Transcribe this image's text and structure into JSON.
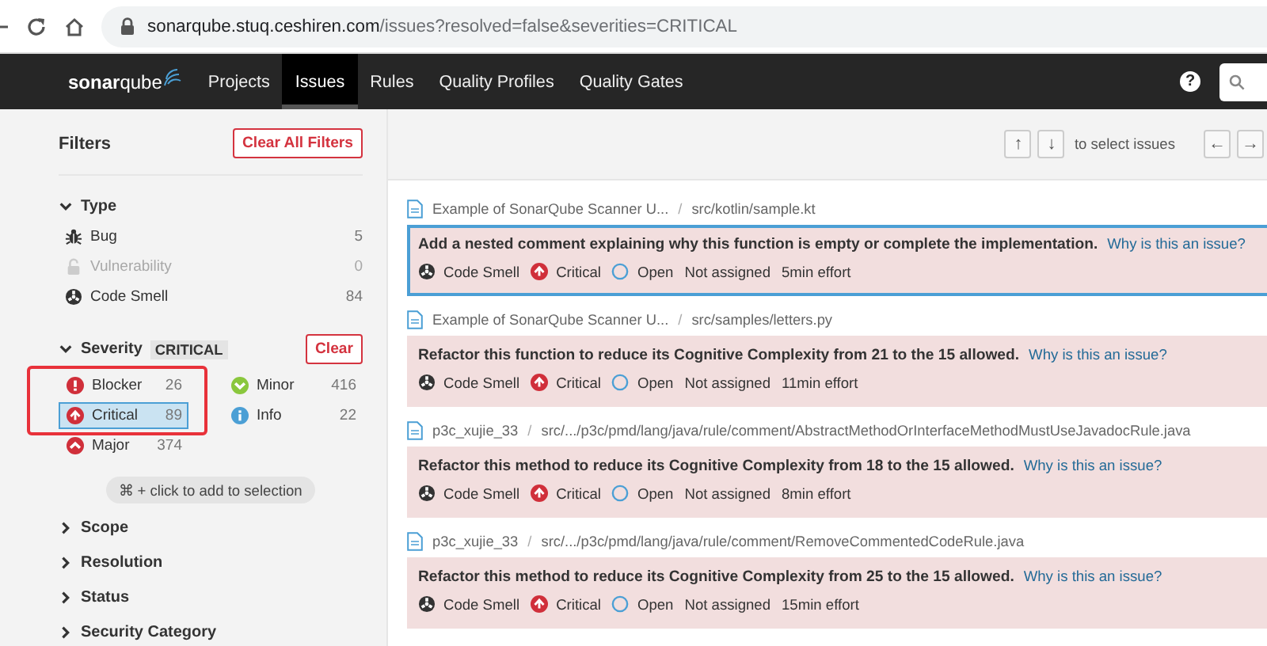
{
  "browser": {
    "url_host": "sonarqube.stuq.ceshiren.com",
    "url_path": "/issues?resolved=false&severities=CRITICAL"
  },
  "nav": {
    "logo": "**sonar**qube",
    "items": [
      {
        "label": "Projects",
        "selected": false
      },
      {
        "label": "Issues",
        "selected": true
      },
      {
        "label": "Rules",
        "selected": false
      },
      {
        "label": "Quality Profiles",
        "selected": false
      },
      {
        "label": "Quality Gates",
        "selected": false
      }
    ],
    "help": "?"
  },
  "sidebar": {
    "title": "Filters",
    "clear_all": "Clear All Filters",
    "type_facet": {
      "title": "Type",
      "expanded": true,
      "items": [
        {
          "kind": "bug",
          "label": "Bug",
          "count": "5",
          "disabled": false
        },
        {
          "kind": "vulnerability",
          "label": "Vulnerability",
          "count": "0",
          "disabled": true
        },
        {
          "kind": "code_smell",
          "label": "Code Smell",
          "count": "84",
          "disabled": false
        }
      ]
    },
    "severity_facet": {
      "title": "Severity",
      "expanded": true,
      "value": "CRITICAL",
      "clear": "Clear",
      "items": [
        {
          "kind": "blocker",
          "label": "Blocker",
          "count": "26",
          "selected": false
        },
        {
          "kind": "critical",
          "label": "Critical",
          "count": "89",
          "selected": true
        },
        {
          "kind": "major",
          "label": "Major",
          "count": "374",
          "selected": false
        },
        {
          "kind": "minor",
          "label": "Minor",
          "count": "416",
          "selected": false
        },
        {
          "kind": "info",
          "label": "Info",
          "count": "22",
          "selected": false
        }
      ],
      "hint": "⌘ + click to add to selection"
    },
    "collapsed_facets": [
      {
        "title": "Scope",
        "expanded": false
      },
      {
        "title": "Resolution",
        "expanded": false
      },
      {
        "title": "Status",
        "expanded": false
      },
      {
        "title": "Security Category",
        "expanded": false
      }
    ]
  },
  "toolbar": {
    "up": "↑",
    "down": "↓",
    "hint": "to select issues",
    "left": "←",
    "right": "→"
  },
  "issues": [
    {
      "project": "Example of SonarQube Scanner U...",
      "separator": "/",
      "path": "src/kotlin/sample.kt",
      "message": "Add a nested comment explaining why this function is empty or complete the implementation.",
      "link": "Why is this an issue?",
      "type": "Code Smell",
      "severity": "Critical",
      "status": "Open",
      "assignee": "Not assigned",
      "effort": "5min effort",
      "selected": true
    },
    {
      "project": "Example of SonarQube Scanner U...",
      "separator": "/",
      "path": "src/samples/letters.py",
      "message": "Refactor this function to reduce its Cognitive Complexity from 21 to the 15 allowed.",
      "link": "Why is this an issue?",
      "type": "Code Smell",
      "severity": "Critical",
      "status": "Open",
      "assignee": "Not assigned",
      "effort": "11min effort",
      "selected": false
    },
    {
      "project": "p3c_xujie_33",
      "separator": "/",
      "path": "src/.../p3c/pmd/lang/java/rule/comment/AbstractMethodOrInterfaceMethodMustUseJavadocRule.java",
      "message": "Refactor this method to reduce its Cognitive Complexity from 18 to the 15 allowed.",
      "link": "Why is this an issue?",
      "type": "Code Smell",
      "severity": "Critical",
      "status": "Open",
      "assignee": "Not assigned",
      "effort": "8min effort",
      "selected": false
    },
    {
      "project": "p3c_xujie_33",
      "separator": "/",
      "path": "src/.../p3c/pmd/lang/java/rule/comment/RemoveCommentedCodeRule.java",
      "message": "Refactor this method to reduce its Cognitive Complexity from 25 to the 15 allowed.",
      "link": "Why is this an issue?",
      "type": "Code Smell",
      "severity": "Critical",
      "status": "Open",
      "assignee": "Not assigned",
      "effort": "15min effort",
      "selected": false
    }
  ]
}
